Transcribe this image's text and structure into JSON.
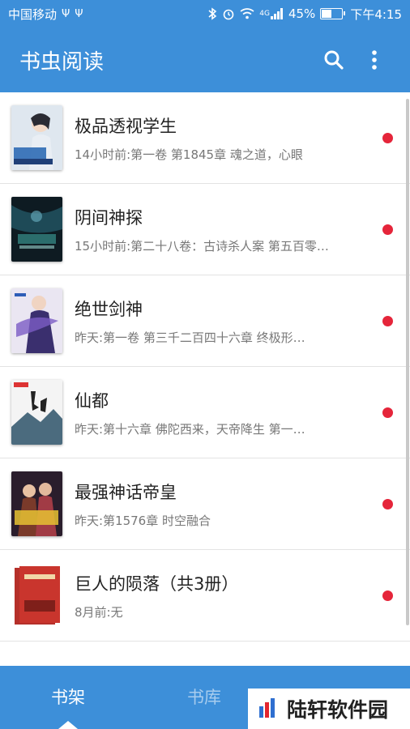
{
  "status": {
    "carrier": "中国移动",
    "usb_icons": [
      "Ψ",
      "Ψ"
    ],
    "battery": "45%",
    "battery_level": 0.45,
    "time": "下午4:15",
    "network": "4G"
  },
  "header": {
    "title": "书虫阅读"
  },
  "books": [
    {
      "title": "极品透视学生",
      "sub": "14小时前:第一卷 第1845章 魂之道，心眼",
      "unread": true
    },
    {
      "title": "阴间神探",
      "sub": "15小时前:第二十八卷：古诗杀人案 第五百零…",
      "unread": true
    },
    {
      "title": "绝世剑神",
      "sub": "昨天:第一卷 第三千二百四十六章 终极形…",
      "unread": true
    },
    {
      "title": "仙都",
      "sub": "昨天:第十六章 佛陀西来，天帝降生 第一…",
      "unread": true
    },
    {
      "title": "最强神话帝皇",
      "sub": "昨天:第1576章 时空融合",
      "unread": true
    },
    {
      "title": "巨人的陨落（共3册）",
      "sub": "8月前:无",
      "unread": true
    }
  ],
  "tabs": {
    "shelf": "书架",
    "library": "书库"
  },
  "watermark": {
    "text": "陆轩软件园"
  },
  "colors": {
    "primary": "#3d8fd9",
    "unread_dot": "#e5253a"
  }
}
